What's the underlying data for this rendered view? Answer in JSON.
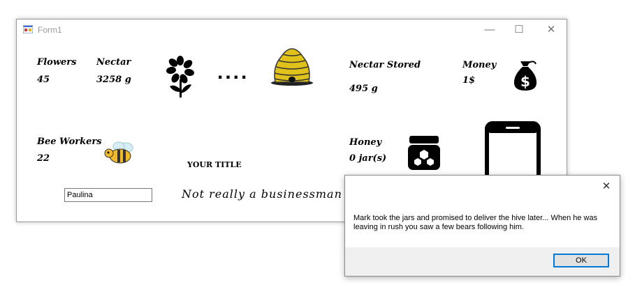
{
  "window": {
    "title": "Form1"
  },
  "stats": {
    "flowers": {
      "label": "Flowers",
      "value": "45"
    },
    "nectar": {
      "label": "Nectar",
      "value": "3258 g"
    },
    "nectar_stored": {
      "label": "Nectar Stored",
      "value": "495 g"
    },
    "money": {
      "label": "Money",
      "value": "1$"
    },
    "bee_workers": {
      "label": "Bee Workers",
      "value": "22"
    },
    "honey": {
      "label": "Honey",
      "value": "0 jar(s)"
    }
  },
  "transfer_dots": "....",
  "your_title": "YOUR TITLE",
  "slogan": "Not really a businessman",
  "player_name": {
    "value": "Paulina"
  },
  "dialog": {
    "message": "Mark took the jars and promised to deliver the hive later... When he was leaving in rush you saw a few bears following him.",
    "ok_label": "OK"
  },
  "icons": [
    "app-icon",
    "minimize-icon",
    "maximize-icon",
    "close-icon",
    "flower-icon",
    "beehive-icon",
    "money-bag-icon",
    "bee-icon",
    "honey-jar-icon",
    "phone-icon"
  ]
}
